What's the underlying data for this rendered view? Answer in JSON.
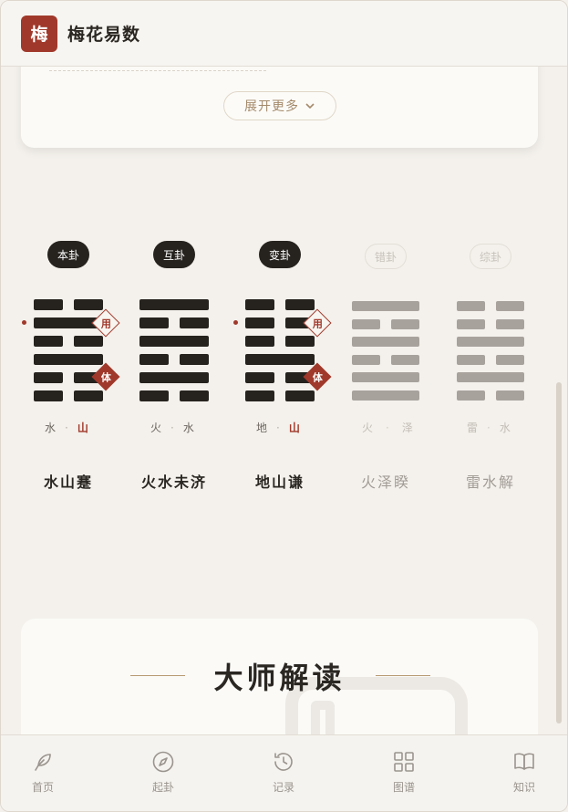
{
  "app": {
    "logo_char": "梅",
    "title": "梅花易数"
  },
  "top_card": {
    "expand_label": "展开更多"
  },
  "hexagrams": [
    {
      "label": "本卦",
      "active": true,
      "upper": "水",
      "lower": "山",
      "name": "水山蹇",
      "yong": "用",
      "ti": "体"
    },
    {
      "label": "互卦",
      "active": true,
      "upper": "火",
      "lower": "水",
      "name": "火水未济"
    },
    {
      "label": "变卦",
      "active": true,
      "upper": "地",
      "lower": "山",
      "name": "地山谦",
      "yong": "用",
      "ti": "体"
    },
    {
      "label": "错卦",
      "active": false,
      "upper": "火",
      "lower": "泽",
      "name": "火泽睽"
    },
    {
      "label": "综卦",
      "active": false,
      "upper": "雷",
      "lower": "水",
      "name": "雷水解"
    }
  ],
  "master": {
    "title": "大师解读"
  },
  "nav": [
    {
      "label": "首页",
      "icon": "feather-icon"
    },
    {
      "label": "起卦",
      "icon": "compass-icon"
    },
    {
      "label": "记录",
      "icon": "history-icon"
    },
    {
      "label": "图谱",
      "icon": "grid-icon"
    },
    {
      "label": "知识",
      "icon": "book-icon"
    }
  ],
  "colors": {
    "accent": "#a0392b",
    "ink": "#26231f",
    "faded": "#a8a29d"
  }
}
